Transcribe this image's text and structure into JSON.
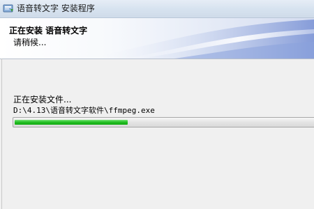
{
  "window": {
    "title": "语音转文字 安装程序",
    "app_icon": "installer-icon"
  },
  "header": {
    "title": "正在安装 语音转文字",
    "subtitle": "请稍候..."
  },
  "body": {
    "status_label": "正在安装文件...",
    "current_file": "D:\\4.13\\语音转文字软件\\ffmpeg.exe",
    "progress_fraction": 0.38
  },
  "colors": {
    "progress_fill": "#22bb22",
    "header_accent": "#5f7fd0"
  }
}
